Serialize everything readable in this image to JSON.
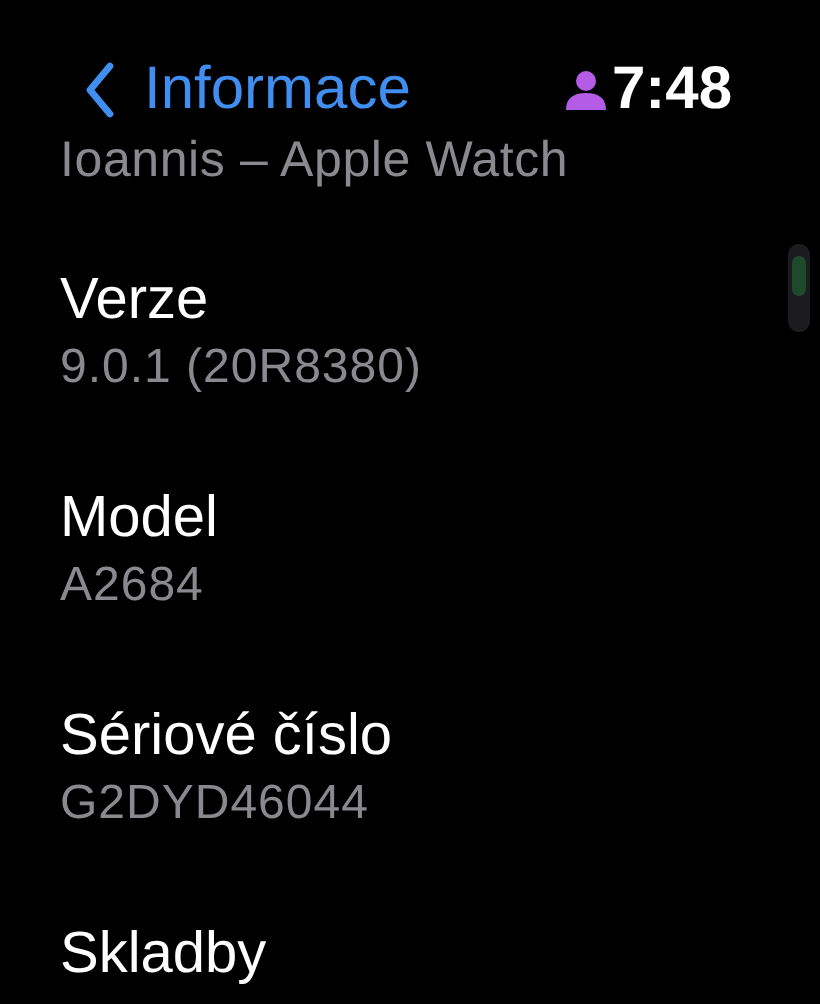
{
  "header": {
    "back_label": "Informace",
    "time": "7:48"
  },
  "subtitle": "Ioannis – Apple Watch",
  "items": [
    {
      "label": "Verze",
      "value": "9.0.1 (20R8380)"
    },
    {
      "label": "Model",
      "value": "A2684"
    },
    {
      "label": "Sériové číslo",
      "value": "G2DYD46044"
    },
    {
      "label": "Skladby"
    }
  ]
}
